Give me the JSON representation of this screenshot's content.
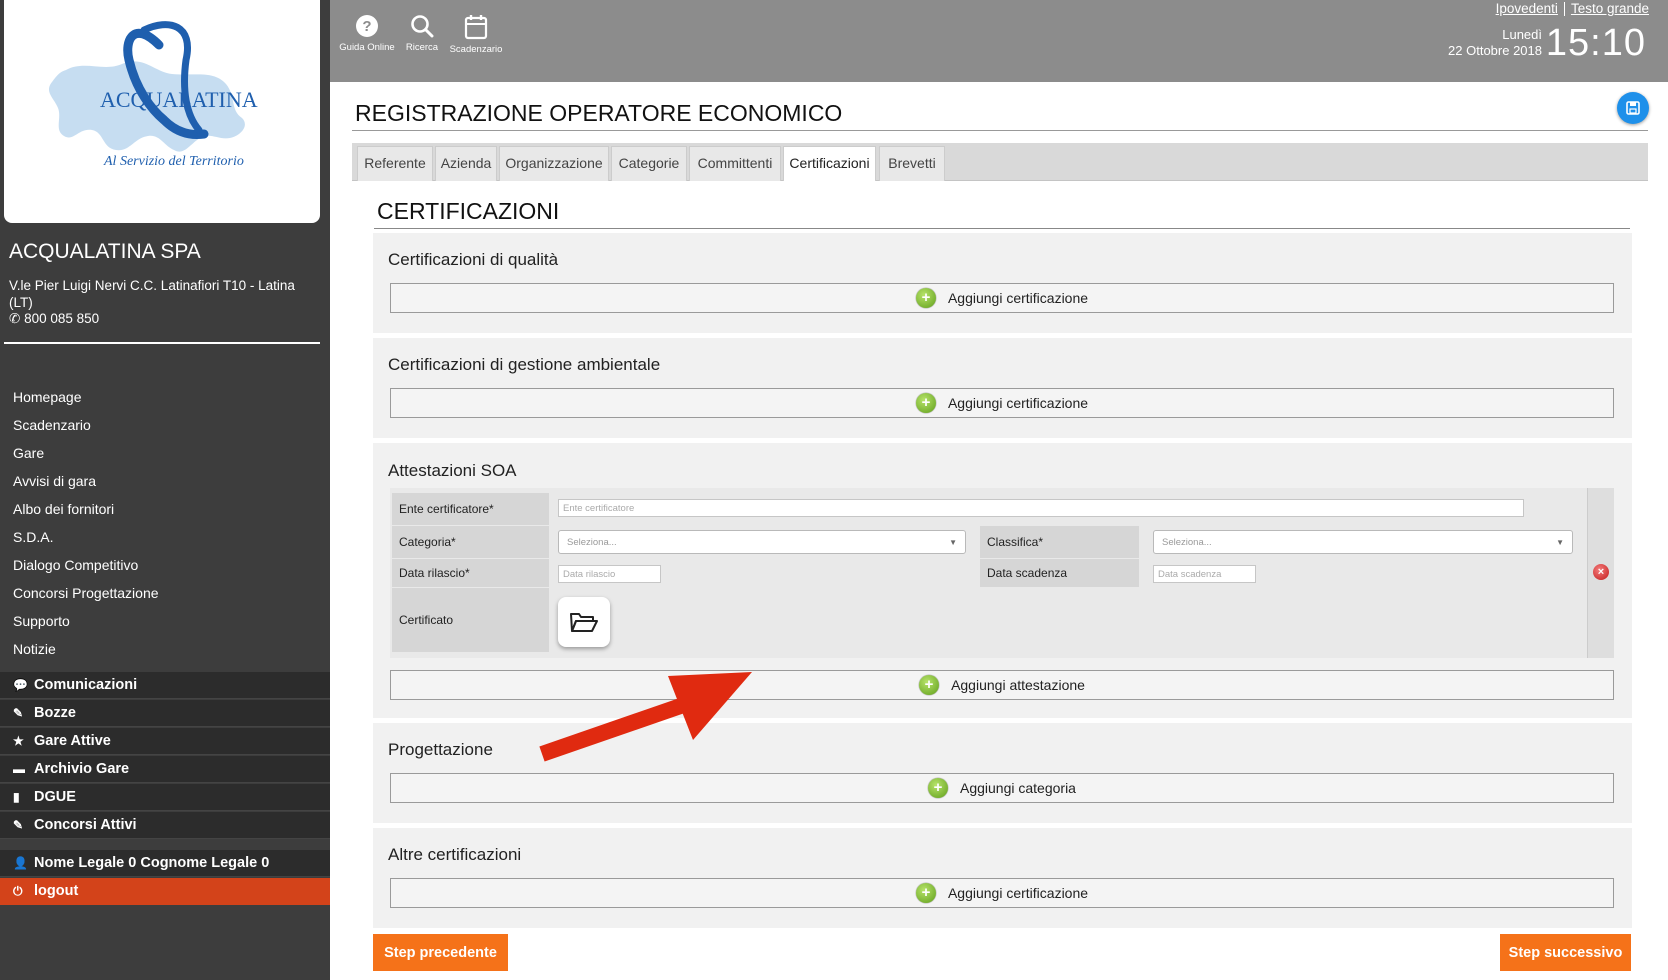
{
  "logo": {
    "brand": "ACQUALATINA",
    "tagline": "Al Servizio del Territorio"
  },
  "sidebar": {
    "company_name": "ACQUALATINA SPA",
    "address": "V.le Pier Luigi Nervi C.C. Latinafiori T10 - Latina (LT)",
    "phone": "800 085 850",
    "nav": [
      "Homepage",
      "Scadenzario",
      "Gare",
      "Avvisi di gara",
      "Albo dei fornitori",
      "S.D.A.",
      "Dialogo Competitivo",
      "Concorsi Progettazione",
      "Supporto",
      "Notizie"
    ],
    "dark_items": [
      {
        "label": "Comunicazioni",
        "icon": "comment-icon"
      },
      {
        "label": "Bozze",
        "icon": "pencil-icon"
      },
      {
        "label": "Gare Attive",
        "icon": "star-icon"
      },
      {
        "label": "Archivio Gare",
        "icon": "folder-icon"
      },
      {
        "label": "DGUE",
        "icon": "document-icon"
      },
      {
        "label": "Concorsi Attivi",
        "icon": "pencil-icon"
      }
    ],
    "user": {
      "label": "Nome Legale 0 Cognome Legale 0",
      "icon": "user-icon"
    },
    "logout": {
      "label": "logout",
      "icon": "power-icon"
    }
  },
  "topbar": {
    "buttons": [
      {
        "label": "Guida Online",
        "icon": "help-icon"
      },
      {
        "label": "Ricerca",
        "icon": "search-icon"
      },
      {
        "label": "Scadenzario",
        "icon": "calendar-icon"
      }
    ],
    "links": [
      "Ipovedenti",
      "Testo grande"
    ],
    "day": "Lunedì",
    "date": "22 Ottobre 2018",
    "time": "15:10"
  },
  "page": {
    "title": "REGISTRAZIONE OPERATORE ECONOMICO",
    "save_icon": "save-icon"
  },
  "tabs": {
    "items": [
      "Referente",
      "Azienda",
      "Organizzazione",
      "Categorie",
      "Committenti",
      "Certificazioni",
      "Brevetti"
    ],
    "active": "Certificazioni"
  },
  "certificazioni": {
    "title": "CERTIFICAZIONI",
    "sections": [
      {
        "title": "Certificazioni di qualità",
        "button": "Aggiungi certificazione"
      },
      {
        "title": "Certificazioni di gestione ambientale",
        "button": "Aggiungi certificazione"
      },
      {
        "title": "Attestazioni SOA",
        "button": "Aggiungi attestazione"
      },
      {
        "title": "Progettazione",
        "button": "Aggiungi categoria"
      },
      {
        "title": "Altre certificazioni",
        "button": "Aggiungi certificazione"
      }
    ],
    "soa_form": {
      "ente_label": "Ente certificatore*",
      "ente_placeholder": "Ente certificatore",
      "categoria_label": "Categoria*",
      "categoria_value": "Seleziona...",
      "classifica_label": "Classifica*",
      "classifica_value": "Seleziona...",
      "data_rilascio_label": "Data rilascio*",
      "data_rilascio_placeholder": "Data rilascio",
      "data_scadenza_label": "Data scadenza",
      "data_scadenza_placeholder": "Data scadenza",
      "certificato_label": "Certificato",
      "upload_icon": "folder-open-icon",
      "remove_icon": "remove-icon"
    }
  },
  "footer": {
    "prev": "Step precedente",
    "next": "Step successivo"
  },
  "colors": {
    "accent_orange": "#f57219",
    "logout_red": "#d3431a",
    "sidebar_bg": "#3d3d3d",
    "topbar_bg": "#8c8c8c",
    "save_blue": "#1e90ea",
    "annotation_arrow": "#e02a10"
  }
}
